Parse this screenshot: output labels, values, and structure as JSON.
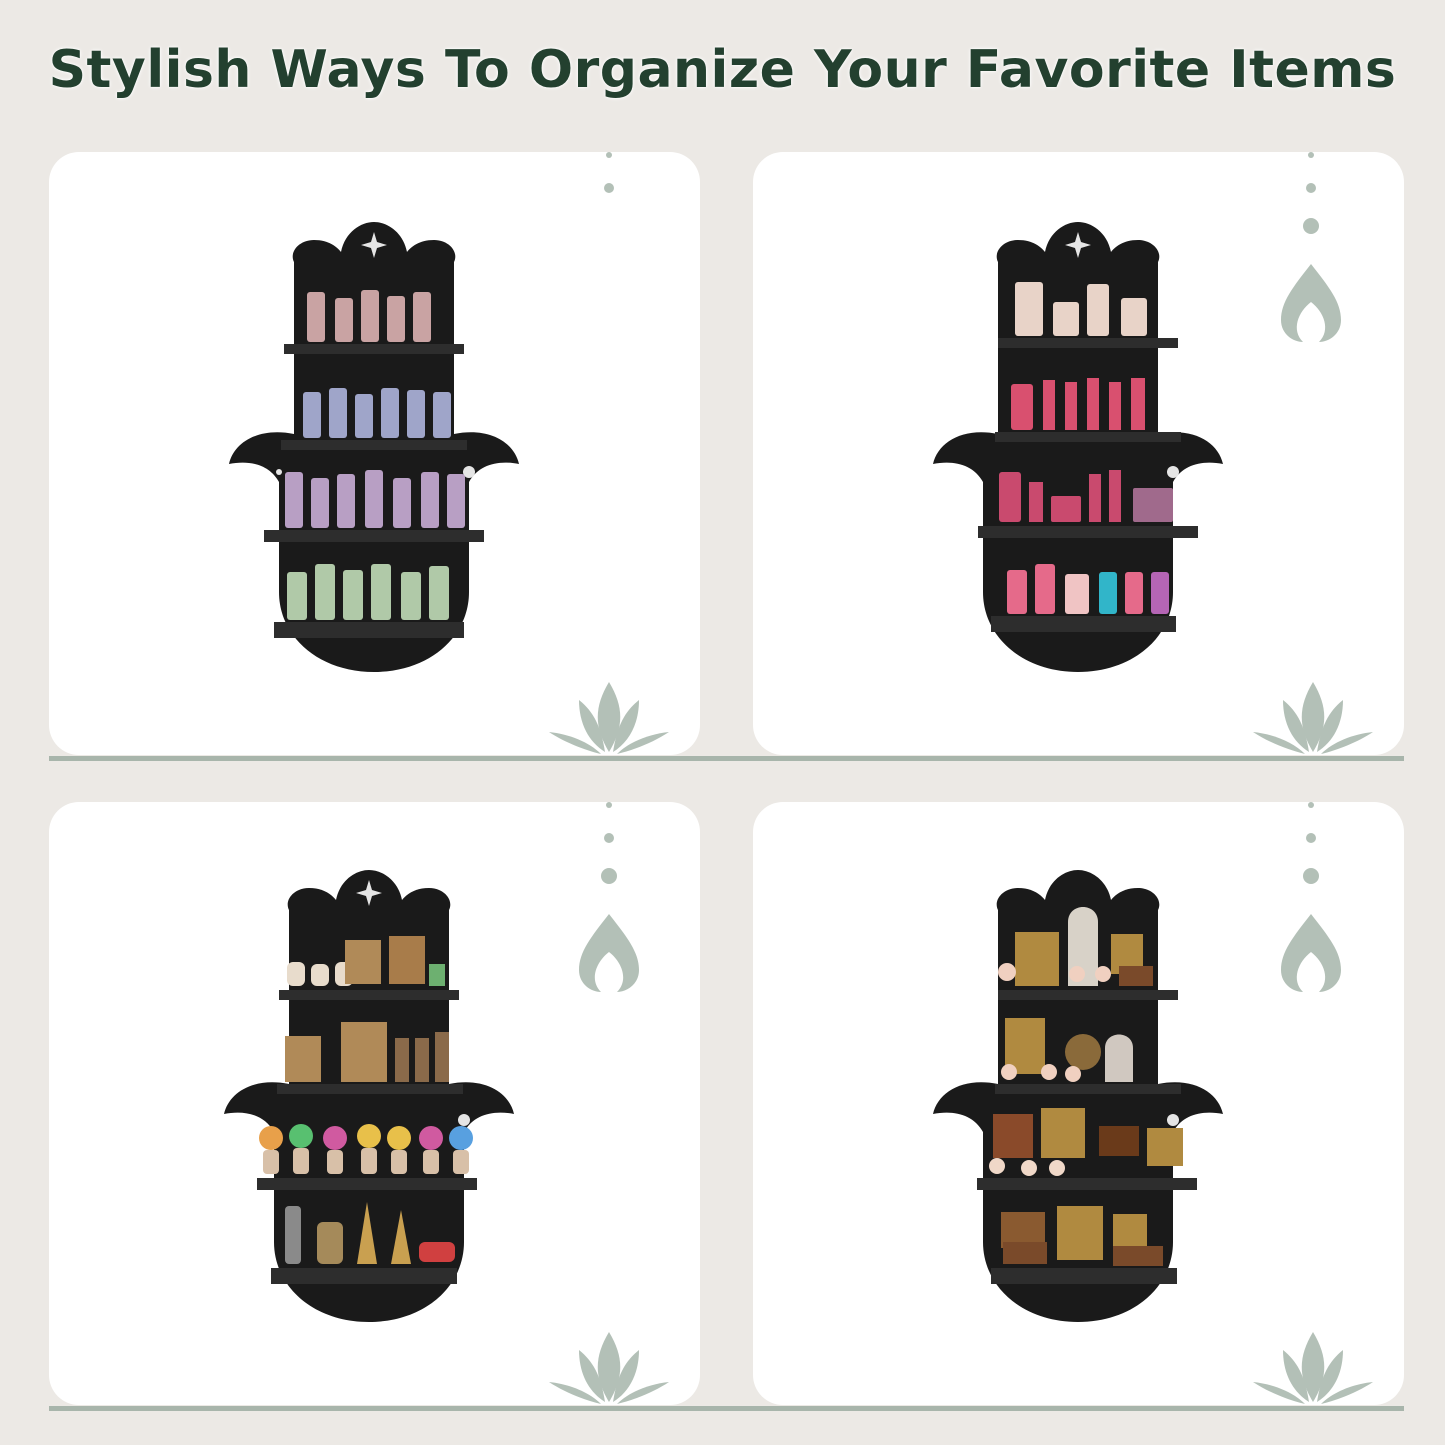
{
  "headline": "Stylish Ways To Organize Your Favorite Items",
  "colors": {
    "background": "#ece9e5",
    "panel": "#ffffff",
    "headline_text": "#23402f",
    "shelf": "#1a1a1a",
    "accent_sage": "#b3c0b7"
  },
  "panels": [
    {
      "contents": "crystal-jar-bottles",
      "decor_icons": [
        "dots-icon",
        "lotus-icon"
      ]
    },
    {
      "contents": "perfume-and-makeup",
      "decor_icons": [
        "dots-icon",
        "flame-icon",
        "lotus-icon"
      ]
    },
    {
      "contents": "figurines-and-frames",
      "decor_icons": [
        "dots-icon",
        "flame-icon",
        "lotus-icon"
      ]
    },
    {
      "contents": "vintage-curios",
      "decor_icons": [
        "dots-icon",
        "flame-icon",
        "lotus-icon"
      ]
    }
  ]
}
